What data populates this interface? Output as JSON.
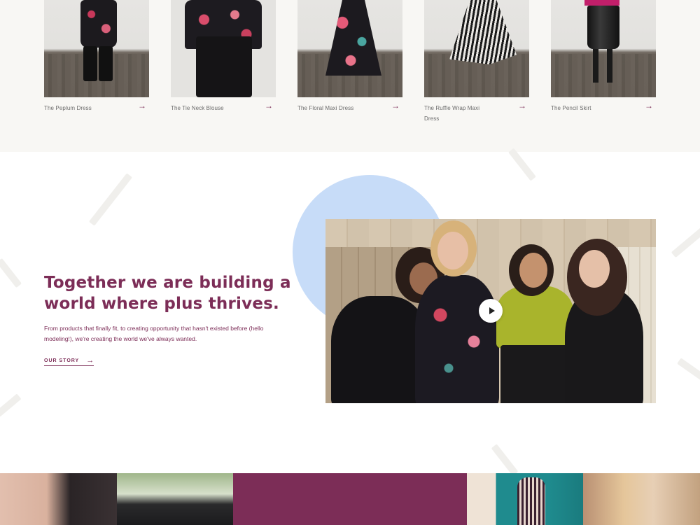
{
  "colors": {
    "brand": "#7c2d57",
    "accent_circle": "#c7dcf8",
    "product_bg": "#f8f7f4"
  },
  "products": [
    {
      "name": "The Peplum Dress",
      "arrow_icon": "arrow-right-icon"
    },
    {
      "name": "The Tie Neck Blouse",
      "arrow_icon": "arrow-right-icon"
    },
    {
      "name": "The Floral Maxi Dress",
      "arrow_icon": "arrow-right-icon"
    },
    {
      "name": "The Ruffle Wrap Maxi Dress",
      "arrow_icon": "arrow-right-icon"
    },
    {
      "name": "The Pencil Skirt",
      "arrow_icon": "arrow-right-icon"
    }
  ],
  "story": {
    "headline": "Together we are building a world where plus thrives.",
    "body": "From products that finally fit, to creating opportunity that hasn't existed before (hello modeling!), we're creating the world we've always wanted.",
    "link_label": "OUR STORY",
    "link_icon": "arrow-right-icon",
    "video_play_icon": "play-icon"
  }
}
